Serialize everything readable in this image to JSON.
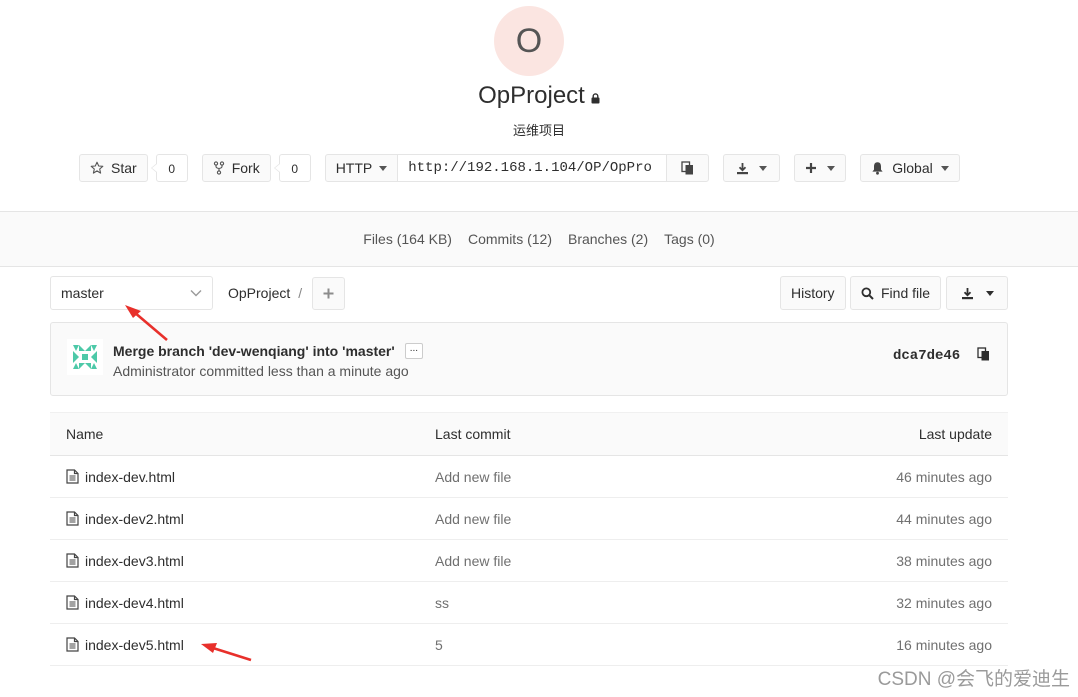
{
  "project": {
    "avatar_letter": "O",
    "name": "OpProject",
    "description": "运维项目"
  },
  "actions": {
    "star_label": "Star",
    "star_count": "0",
    "fork_label": "Fork",
    "fork_count": "0",
    "clone_protocol": "HTTP",
    "clone_url": "http://192.168.1.104/OP/OpPro",
    "notification_label": "Global"
  },
  "nav": {
    "files": "Files (164 KB)",
    "commits": "Commits (12)",
    "branches": "Branches (2)",
    "tags": "Tags (0)"
  },
  "tree": {
    "branch": "master",
    "breadcrumb_root": "OpProject",
    "breadcrumb_sep": "/",
    "history_label": "History",
    "find_file_label": "Find file"
  },
  "commit": {
    "title": "Merge branch 'dev-wenqiang' into 'master'",
    "ellipsis": "...",
    "meta": "Administrator committed less than a minute ago",
    "sha": "dca7de46"
  },
  "files": {
    "headers": {
      "name": "Name",
      "last_commit": "Last commit",
      "last_update": "Last update"
    },
    "rows": [
      {
        "name": "index-dev.html",
        "commit": "Add new file",
        "updated": "46 minutes ago"
      },
      {
        "name": "index-dev2.html",
        "commit": "Add new file",
        "updated": "44 minutes ago"
      },
      {
        "name": "index-dev3.html",
        "commit": "Add new file",
        "updated": "38 minutes ago"
      },
      {
        "name": "index-dev4.html",
        "commit": "ss",
        "updated": "32 minutes ago"
      },
      {
        "name": "index-dev5.html",
        "commit": "5",
        "updated": "16 minutes ago"
      }
    ]
  },
  "watermark": "CSDN @会飞的爱迪生",
  "colors": {
    "avatar_bg": "#fbe5e1",
    "identicon": "#4dc9a8",
    "annotation_arrow": "#e8302b"
  },
  "icons": {
    "star": "star-icon",
    "fork": "fork-icon",
    "copy": "clipboard-icon",
    "download": "download-icon",
    "plus": "plus-icon",
    "bell": "bell-icon",
    "search": "search-icon",
    "file": "file-icon",
    "lock": "lock-icon"
  }
}
